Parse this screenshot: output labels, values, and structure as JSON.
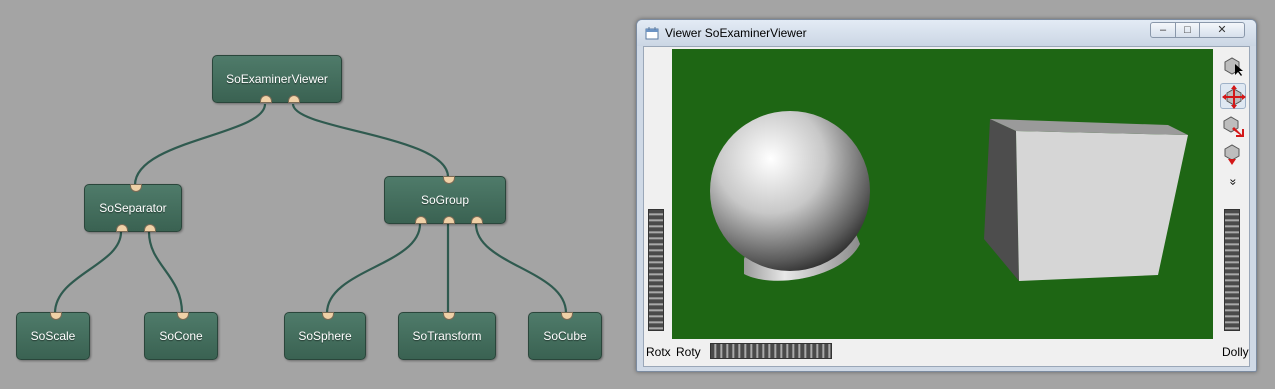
{
  "graph": {
    "nodes": {
      "examiner": "SoExaminerViewer",
      "separator": "SoSeparator",
      "group": "SoGroup",
      "scale": "SoScale",
      "cone": "SoCone",
      "sphere": "SoSphere",
      "transform": "SoTransform",
      "cube": "SoCube"
    }
  },
  "viewer": {
    "title": "Viewer SoExaminerViewer",
    "buttons": {
      "minimize": "–",
      "maximize": "□",
      "close": "✕"
    },
    "tools": [
      "select-arrow-icon",
      "rotate-view-icon",
      "seek-icon",
      "home-icon",
      "more-chevron-icon"
    ],
    "more_label": "»",
    "labels": {
      "rotx": "Rotx",
      "roty": "Roty",
      "dolly": "Dolly"
    },
    "scene_color": "#1e6614"
  }
}
